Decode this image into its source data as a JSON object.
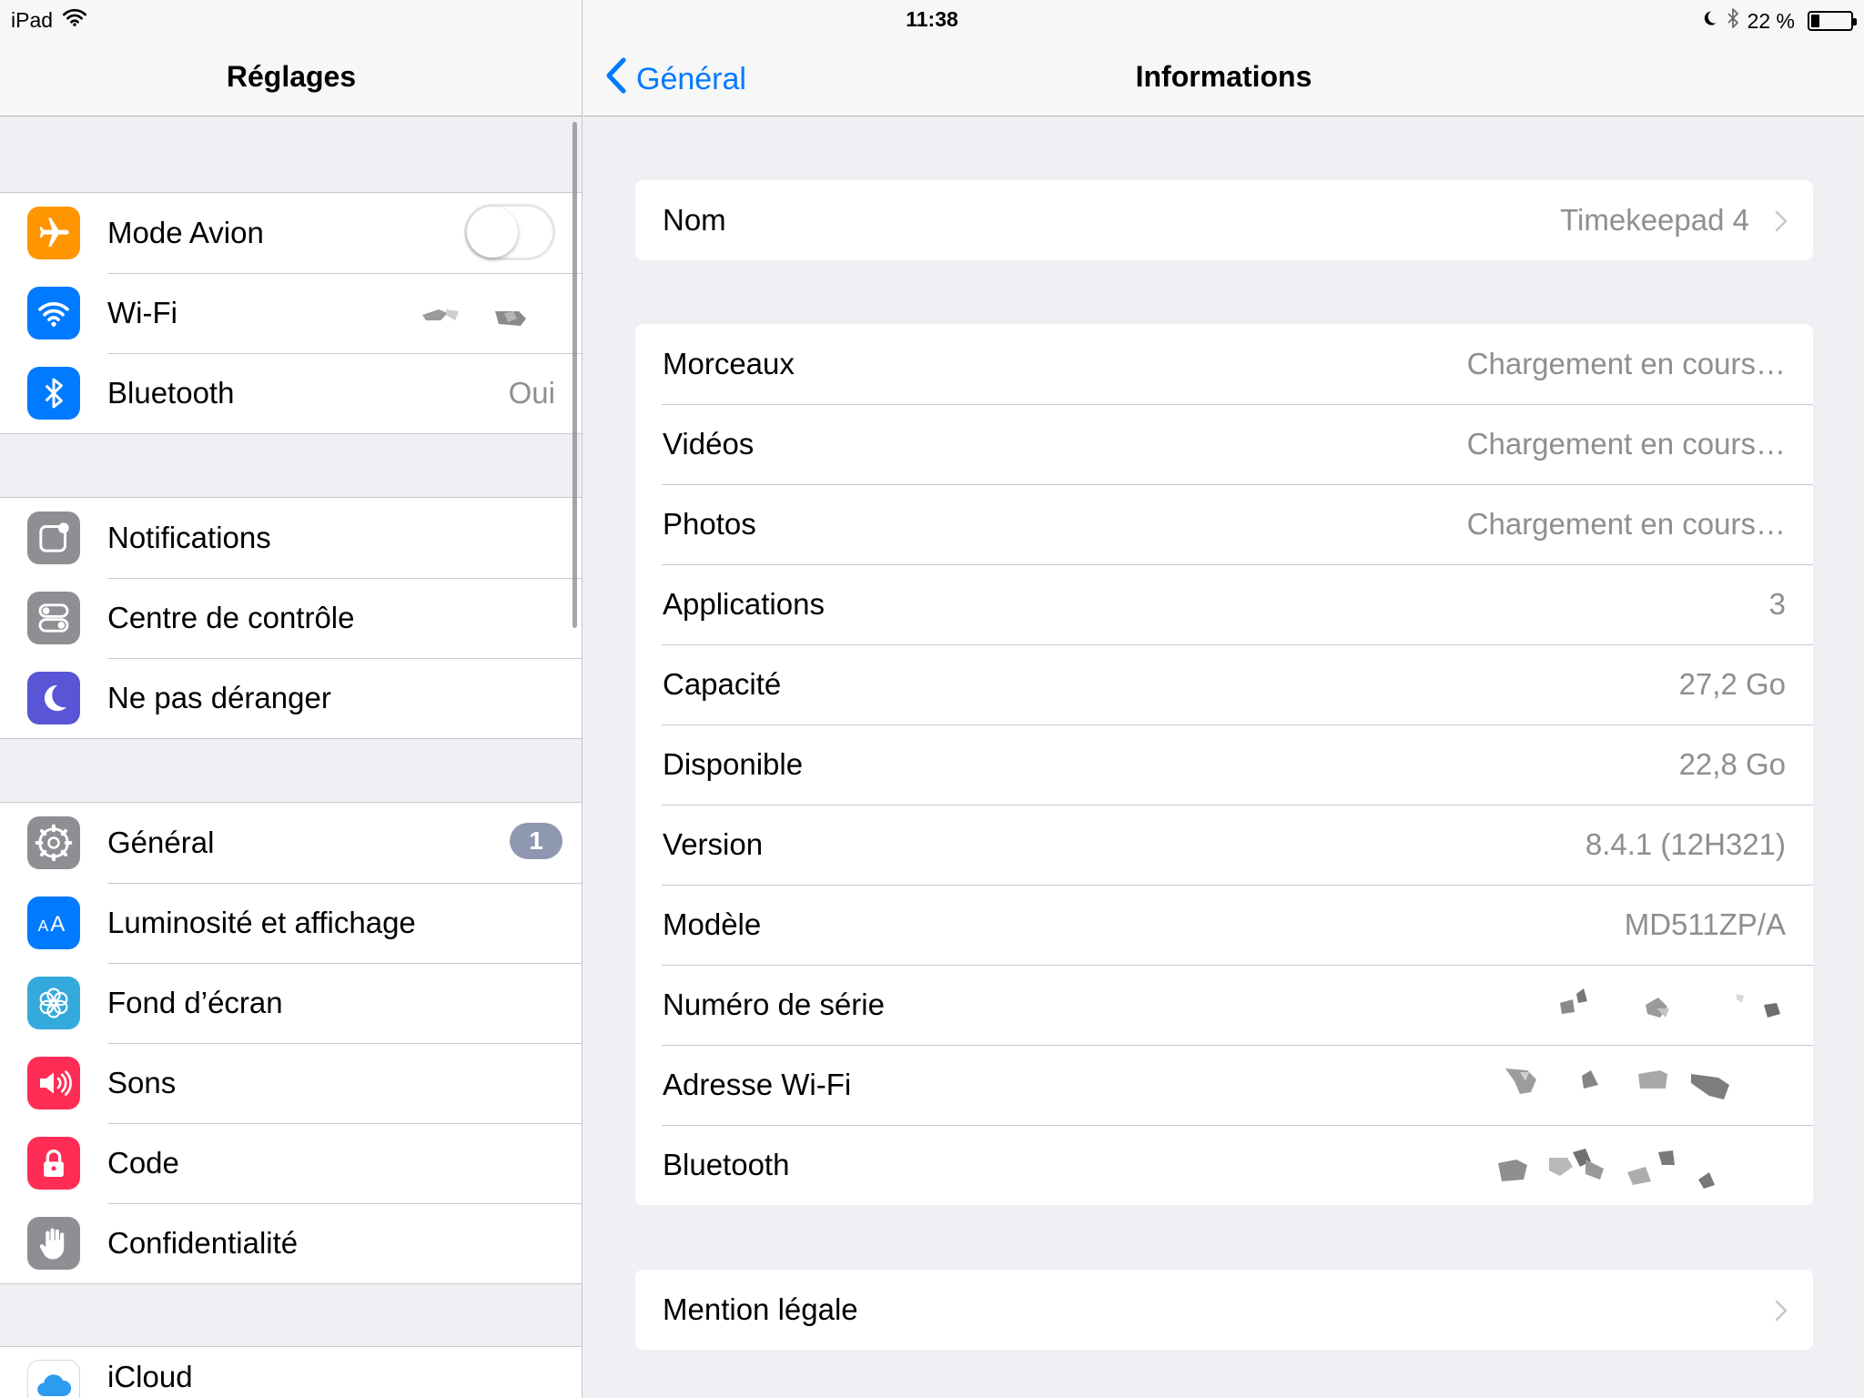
{
  "status_bar": {
    "device": "iPad",
    "time": "11:38",
    "battery_percent": "22 %",
    "battery_level": 0.22
  },
  "master": {
    "title": "Réglages",
    "groups": [
      {
        "items": [
          {
            "label": "Mode Avion",
            "icon": "airplane-icon",
            "color": "#ff9500",
            "toggle": false
          },
          {
            "label": "Wi-Fi",
            "icon": "wifi-icon",
            "color": "#007aff"
          },
          {
            "label": "Bluetooth",
            "icon": "bluetooth-icon",
            "color": "#007aff",
            "value": "Oui"
          }
        ]
      },
      {
        "items": [
          {
            "label": "Notifications",
            "icon": "notifications-icon",
            "color": "#8e8e93"
          },
          {
            "label": "Centre de contrôle",
            "icon": "control-center-icon",
            "color": "#8e8e93"
          },
          {
            "label": "Ne pas déranger",
            "icon": "moon-icon",
            "color": "#5856d6"
          }
        ]
      },
      {
        "items": [
          {
            "label": "Général",
            "icon": "gear-icon",
            "color": "#8e8e93",
            "badge": "1"
          },
          {
            "label": "Luminosité et affichage",
            "icon": "brightness-icon",
            "color": "#007aff"
          },
          {
            "label": "Fond d’écran",
            "icon": "wallpaper-icon",
            "color": "#34aadc"
          },
          {
            "label": "Sons",
            "icon": "speaker-icon",
            "color": "#ff2d55"
          },
          {
            "label": "Code",
            "icon": "lock-icon",
            "color": "#ff2d55"
          },
          {
            "label": "Confidentialité",
            "icon": "hand-icon",
            "color": "#8e8e93"
          }
        ]
      },
      {
        "items": [
          {
            "label": "iCloud",
            "icon": "cloud-icon",
            "color": "#ffffff"
          }
        ]
      }
    ]
  },
  "detail": {
    "back_label": "Général",
    "title": "Informations",
    "name_row": {
      "label": "Nom",
      "value": "Timekeepad 4"
    },
    "info_rows": [
      {
        "label": "Morceaux",
        "value": "Chargement en cours…"
      },
      {
        "label": "Vidéos",
        "value": "Chargement en cours…"
      },
      {
        "label": "Photos",
        "value": "Chargement en cours…"
      },
      {
        "label": "Applications",
        "value": "3"
      },
      {
        "label": "Capacité",
        "value": "27,2 Go"
      },
      {
        "label": "Disponible",
        "value": "22,8 Go"
      },
      {
        "label": "Version",
        "value": "8.4.1 (12H321)"
      },
      {
        "label": "Modèle",
        "value": "MD511ZP/A"
      },
      {
        "label": "Numéro de série",
        "value": ""
      },
      {
        "label": "Adresse Wi-Fi",
        "value": ""
      },
      {
        "label": "Bluetooth",
        "value": ""
      }
    ],
    "legal_row": {
      "label": "Mention légale"
    }
  },
  "colors": {
    "accent": "#007aff",
    "badge": "#8e98b0",
    "secondary_text": "#8e8e93",
    "separator": "#c8c7cc",
    "background": "#efeff4"
  }
}
